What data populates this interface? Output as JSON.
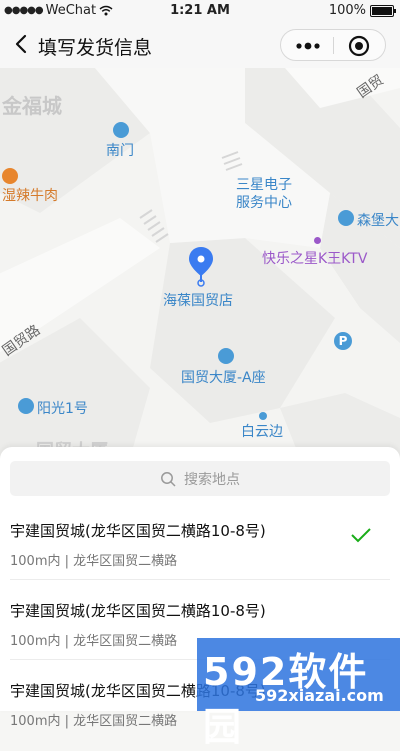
{
  "status": {
    "carrier": "WeChat",
    "time": "1:21 AM",
    "battery": "100%"
  },
  "nav": {
    "title": "填写发货信息"
  },
  "map": {
    "labels": {
      "jinfucheng": "金福城",
      "guomao_road_top": "国贸",
      "nanmen": "南门",
      "sanxing": "三星电子",
      "sanxing2": "服务中心",
      "senbao": "森堡大",
      "xianglaniurou": "湿辣牛肉",
      "ktv": "快乐之星K王KTV",
      "haichen": "海葆国贸店",
      "guomaolu": "国贸路",
      "guomao_a": "国贸大厦-A座",
      "yangguang": "阳光1号",
      "baiyunbian": "白云边",
      "guomaodasha_bg": "国贸大厦"
    },
    "parking_glyph": "P"
  },
  "search": {
    "placeholder": "搜索地点"
  },
  "results": [
    {
      "name": "宇建国贸城(龙华区国贸二横路10-8号)",
      "detail": "100m内 | 龙华区国贸二横路",
      "selected": true
    },
    {
      "name": "宇建国贸城(龙华区国贸二横路10-8号)",
      "detail": "100m内 | 龙华区国贸二横路",
      "selected": false
    },
    {
      "name": "宇建国贸城(龙华区国贸二横路10-8号)",
      "detail": "100m内 | 龙华区国贸二横路",
      "selected": false
    }
  ],
  "watermark": {
    "big": "592软件园",
    "url": "592xiazai.com"
  },
  "colors": {
    "accent_green": "#1aad19",
    "poi_blue": "#4a9bd6",
    "poi_orange": "#e8862e",
    "poi_purple": "#9b59c9",
    "pin_blue": "#3a7bf0"
  }
}
